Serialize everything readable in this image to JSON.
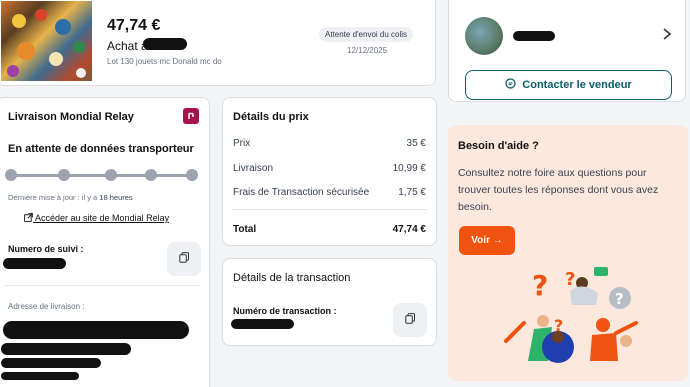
{
  "order": {
    "price": "47,74 €",
    "title": "Achat à",
    "description": "Lot 130 jouets mc Donald mc do",
    "status_badge": "Attente d'envoi du colis",
    "date": "12/12/2025"
  },
  "seller": {
    "contact_label": "Contacter le vendeur"
  },
  "delivery": {
    "title": "Livraison Mondial Relay",
    "status": "En attente de données transporteur",
    "last_update_prefix": "Dernière mise à jour : il y a",
    "last_update_value": "18 heures",
    "link_label": "Accéder au site de Mondial Relay",
    "tracking_label": "Numero de suivi :",
    "address_label": "Adresse de livraison :",
    "progress_steps": 5,
    "progress_current": 1
  },
  "price_details": {
    "title": "Détails du prix",
    "rows": [
      {
        "label": "Prix",
        "value": "35 €"
      },
      {
        "label": "Livraison",
        "value": "10,99 €"
      },
      {
        "label": "Frais de Transaction sécurisée",
        "value": "1,75 €"
      }
    ],
    "total_label": "Total",
    "total_value": "47,74 €"
  },
  "transaction": {
    "title": "Détails de la transaction",
    "number_label": "Numéro de transaction :"
  },
  "help": {
    "title": "Besoin d'aide ?",
    "text": "Consultez notre foire aux questions pour trouver toutes les réponses dont vous avez besoin.",
    "button_label": "Voir →"
  },
  "colors": {
    "accent": "#0b5e6b",
    "help_bg": "#fde8de",
    "cta_orange": "#f0520f",
    "mondial_relay": "#a1154a"
  }
}
